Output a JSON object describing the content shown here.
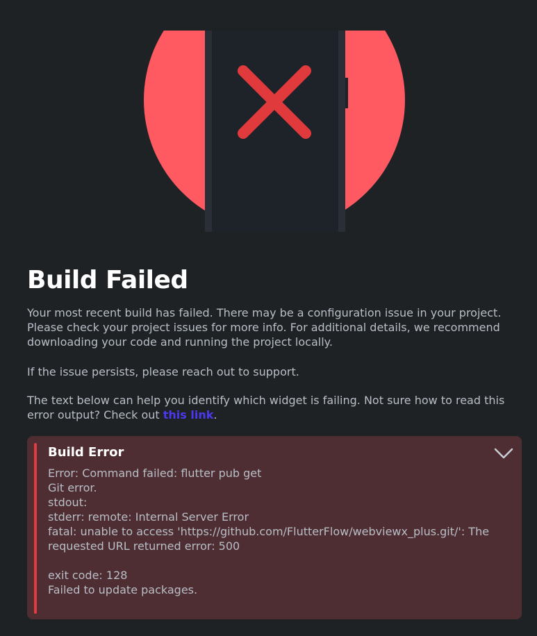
{
  "illustration": {
    "icon": "phone-error-x-icon",
    "circle_color": "#ff5962",
    "phone_color": "#1e2229",
    "x_color": "#e03a3d"
  },
  "heading": {
    "title": "Build Failed"
  },
  "description": {
    "p1": "Your most recent build has failed. There may be a configuration issue in your project. Please check your project issues for more info. For additional details, we recommend downloading your code and running the project locally.",
    "p2": "If the issue persists, please reach out to support.",
    "p3_prefix": "The text below can help you identify which widget is failing. Not sure how to read this error output? Check out ",
    "p3_link": "this link",
    "p3_suffix": "."
  },
  "error_panel": {
    "title": "Build Error",
    "toggle_icon": "chevron-down-icon",
    "lines": [
      "Error: Command failed: flutter pub get",
      "Git error.",
      "stdout:",
      "stderr: remote: Internal Server Error",
      "fatal: unable to access 'https://github.com/FlutterFlow/webviewx_plus.git/': The",
      "requested URL returned error: 500",
      "",
      "exit code: 128",
      "Failed to update packages."
    ]
  },
  "colors": {
    "background": "#1f2225",
    "error_panel_bg": "#4f2e33",
    "error_accent": "#e53b3f",
    "link": "#4b39ef",
    "body_text": "#b8bfc7"
  }
}
